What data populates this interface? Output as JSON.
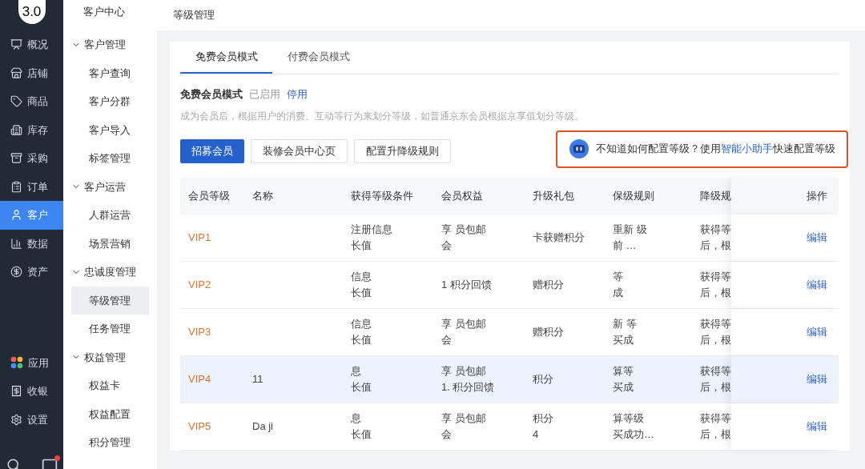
{
  "logo": "3.0",
  "nav": [
    {
      "label": "概况",
      "selected": false
    },
    {
      "label": "店铺",
      "selected": false
    },
    {
      "label": "商品",
      "selected": false
    },
    {
      "label": "库存",
      "selected": false
    },
    {
      "label": "采购",
      "selected": false
    },
    {
      "label": "订单",
      "selected": false
    },
    {
      "label": "客户",
      "selected": true
    },
    {
      "label": "数据",
      "selected": false
    },
    {
      "label": "资产",
      "selected": false
    }
  ],
  "nav_bottom": [
    {
      "label": "应用",
      "selected": false
    },
    {
      "label": "收银",
      "selected": false
    },
    {
      "label": "设置",
      "selected": false
    }
  ],
  "submenu": {
    "title": "客户中心",
    "groups": [
      {
        "title": "客户管理",
        "expanded": true,
        "children": [
          {
            "label": "客户查询",
            "selected": false
          },
          {
            "label": "客户分群",
            "selected": false
          },
          {
            "label": "客户导入",
            "selected": false
          },
          {
            "label": "标签管理",
            "selected": false
          }
        ]
      },
      {
        "title": "客户运营",
        "expanded": true,
        "children": [
          {
            "label": "人群运营",
            "selected": false
          },
          {
            "label": "场景营销",
            "selected": false
          }
        ]
      },
      {
        "title": "忠诚度管理",
        "expanded": true,
        "children": [
          {
            "label": "等级管理",
            "selected": true
          },
          {
            "label": "任务管理",
            "selected": false
          }
        ]
      },
      {
        "title": "权益管理",
        "expanded": true,
        "children": [
          {
            "label": "权益卡",
            "selected": false
          },
          {
            "label": "权益配置",
            "selected": false
          },
          {
            "label": "积分管理",
            "selected": false
          }
        ]
      }
    ]
  },
  "page_title": "等级管理",
  "tabs": [
    {
      "label": "免费会员模式",
      "selected": true
    },
    {
      "label": "付费会员模式",
      "selected": false
    }
  ],
  "mode": {
    "title": "免费会员模式",
    "status": "已启用",
    "action": "停用",
    "description": "成为会员后，根据用户的消费、互动等行为来划分等级，如普通京东会员根据京享值划分等级。"
  },
  "buttons": [
    {
      "label": "招募会员",
      "kind": "primary"
    },
    {
      "label": "装修会员中心页",
      "kind": "default"
    },
    {
      "label": "配置升降级规则",
      "kind": "default"
    }
  ],
  "assistant_tip": {
    "text": "不知道如何配置等级？使用",
    "link": "智能小助手",
    "suffix": "快速配置等级"
  },
  "table": {
    "columns": [
      "会员等级",
      "名称",
      "获得等级条件",
      "会员权益",
      "升级礼包",
      "保级规则",
      "降级规",
      "操作"
    ],
    "rows": [
      {
        "level": "VIP1",
        "condition": [
          "注册信息",
          "长值"
        ],
        "benefit": [
          "享 员包邮",
          "会"
        ],
        "gift": [
          "卡获赠积分"
        ],
        "keep": [
          "重新 级",
          "前 …"
        ],
        "downgrade": [
          "获得等",
          "后，根"
        ],
        "action": "编辑",
        "selected": false
      },
      {
        "level": "VIP2",
        "condition": [
          "信息",
          "长值"
        ],
        "benefit": [
          "1 积分回馈"
        ],
        "gift": [
          "赠积分"
        ],
        "keep": [
          "等",
          "成"
        ],
        "downgrade": [
          "获得等",
          "后，根"
        ],
        "action": "编辑",
        "selected": false
      },
      {
        "level": "VIP3",
        "condition": [
          "信息",
          "长值"
        ],
        "benefit": [
          "享 员包邮",
          "会"
        ],
        "gift": [
          "赠积分"
        ],
        "keep": [
          "新 等",
          "买成"
        ],
        "downgrade": [
          "获得等",
          "后，根"
        ],
        "action": "编辑",
        "selected": false
      },
      {
        "level": "VIP4",
        "name": "11",
        "condition": [
          "息",
          "长值"
        ],
        "benefit": [
          "享 员包邮",
          "1. 积分回馈"
        ],
        "gift": [
          "积分"
        ],
        "keep": [
          "算等",
          "买成"
        ],
        "downgrade": [
          "获得等",
          "后，根"
        ],
        "action": "编辑",
        "selected": true
      },
      {
        "level": "VIP5",
        "name": "Da ji",
        "condition": [
          "息",
          "长值"
        ],
        "benefit": [
          "享 员包邮",
          "会"
        ],
        "gift": [
          "积分",
          "4"
        ],
        "keep": [
          "算等级",
          "买成功…"
        ],
        "downgrade": [
          "获得等",
          "后，根"
        ],
        "action": "编辑",
        "selected": false
      }
    ]
  }
}
